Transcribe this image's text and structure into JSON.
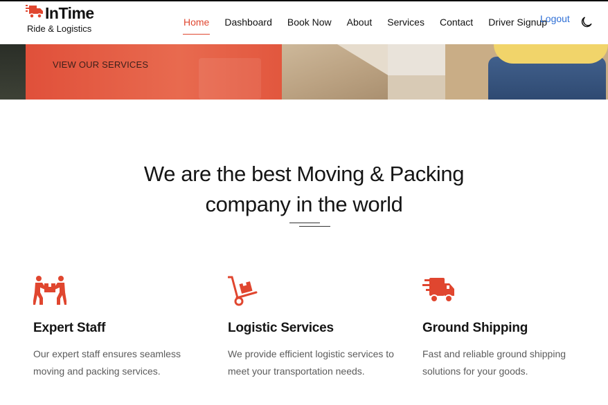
{
  "brand": {
    "name": "InTime",
    "tagline": "Ride & Logistics",
    "icon": "truck-icon"
  },
  "nav": {
    "items": [
      {
        "label": "Home",
        "active": true
      },
      {
        "label": "Dashboard",
        "active": false
      },
      {
        "label": "Book Now",
        "active": false
      },
      {
        "label": "About",
        "active": false
      },
      {
        "label": "Services",
        "active": false
      },
      {
        "label": "Contact",
        "active": false
      },
      {
        "label": "Driver Signup",
        "active": false
      }
    ],
    "logout": "Logout",
    "theme_toggle_icon": "moon-icon"
  },
  "hero": {
    "cta": "VIEW OUR SERVICES"
  },
  "section": {
    "heading_line1": "We are the best Moving & Packing",
    "heading_line2": "company in the world"
  },
  "features": [
    {
      "icon": "movers-carrying-box-icon",
      "title": "Expert Staff",
      "text_line1": "Our expert staff ensures seamless",
      "text_line2": "moving and packing services."
    },
    {
      "icon": "hand-truck-dolly-icon",
      "title": "Logistic Services",
      "text_line1": "We provide efficient logistic services to",
      "text_line2": "meet your transportation needs."
    },
    {
      "icon": "fast-delivery-truck-icon",
      "title": "Ground Shipping",
      "text_line1": "Fast and reliable ground shipping",
      "text_line2": "solutions for your goods."
    }
  ],
  "colors": {
    "accent": "#e0462f",
    "link": "#2e6fd6",
    "text": "#151515",
    "muted": "#5b5b5b"
  }
}
